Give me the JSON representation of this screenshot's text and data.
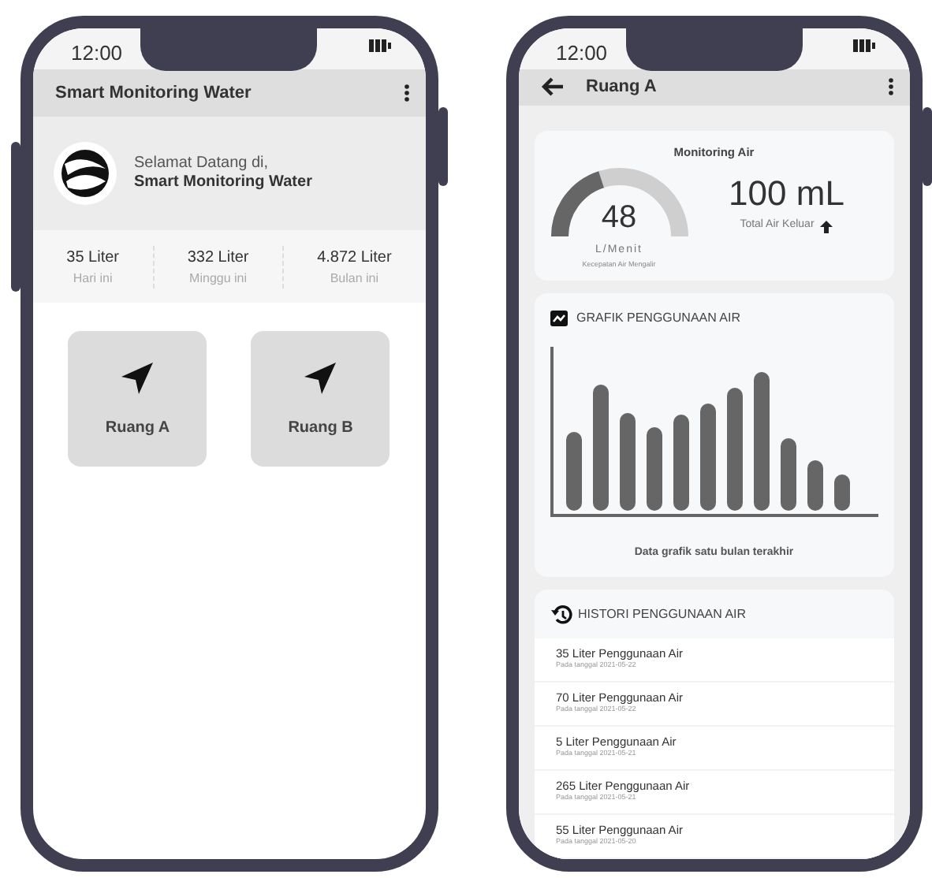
{
  "phones": [
    {
      "kind": "home",
      "status_time": "12:00",
      "app_bar": {
        "title": "Smart Monitoring Water",
        "back": false
      },
      "welcome": {
        "greeting": "Selamat Datang di,",
        "app_name": "Smart Monitoring Water"
      },
      "stats": [
        {
          "value": "35 Liter",
          "label": "Hari ini"
        },
        {
          "value": "332 Liter",
          "label": "Minggu ini"
        },
        {
          "value": "4.872 Liter",
          "label": "Bulan ini"
        }
      ],
      "rooms": [
        {
          "label": "Ruang A"
        },
        {
          "label": "Ruang B"
        }
      ]
    },
    {
      "kind": "detail",
      "status_time": "12:00",
      "app_bar": {
        "title": "Ruang A",
        "back": true
      },
      "monitoring": {
        "title": "Monitoring Air",
        "gauge": {
          "level": 0.4,
          "value": "48",
          "unit": "L/Menit",
          "caption": "Kecepatan Air Mengalir"
        },
        "total": {
          "value": "100 mL",
          "label": "Total Air Keluar"
        }
      },
      "chart": {
        "title": "GRAFIK PENGGUNAAN AIR",
        "caption": "Data grafik satu bulan terakhir"
      },
      "history": {
        "title": "HISTORI PENGGUNAAN AIR",
        "items": [
          {
            "amount": "35 Liter Penggunaan Air",
            "date": "Pada tanggal 2021-05-22"
          },
          {
            "amount": "70 Liter Penggunaan Air",
            "date": "Pada tanggal 2021-05-22"
          },
          {
            "amount": "5 Liter Penggunaan Air",
            "date": "Pada tanggal 2021-05-21"
          },
          {
            "amount": "265 Liter Penggunaan Air",
            "date": "Pada tanggal 2021-05-21"
          },
          {
            "amount": "55 Liter Penggunaan Air",
            "date": "Pada tanggal 2021-05-20"
          }
        ]
      }
    }
  ]
}
